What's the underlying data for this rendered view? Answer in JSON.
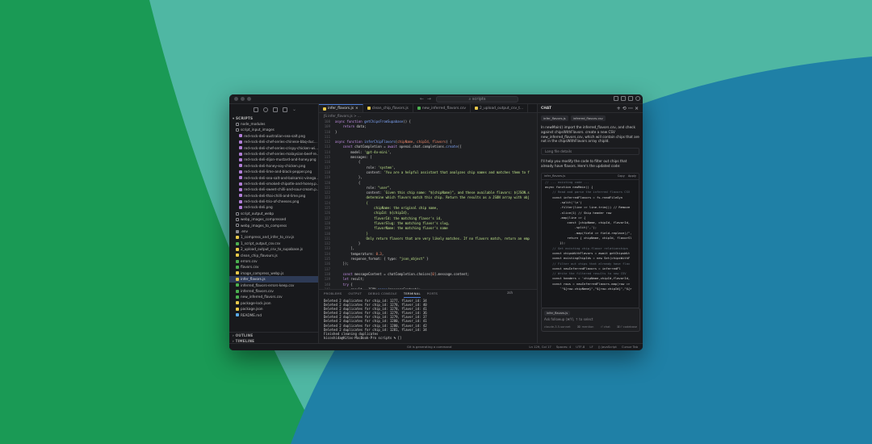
{
  "window": {
    "command_center": "scripts",
    "nav_arrows": "← →"
  },
  "explorer": {
    "section": "SCRIPTS",
    "items": [
      {
        "label": "node_modules",
        "indent": 1,
        "kind": "folder",
        "color": "#bdbdbd"
      },
      {
        "label": "script_input_images",
        "indent": 1,
        "kind": "folder",
        "color": "#bdbdbd"
      },
      {
        "label": "red-rock-deli-australian-sea-salt.png",
        "indent": 2,
        "kind": "img",
        "color": "#bdbdbd"
      },
      {
        "label": "red-rock-deli-chef-series-chinese-bbq-duc...",
        "indent": 2,
        "kind": "img",
        "color": "#bdbdbd"
      },
      {
        "label": "red-rock-deli-chef-series-crispy-chicken-wi...",
        "indent": 2,
        "kind": "img",
        "color": "#bdbdbd"
      },
      {
        "label": "red-rock-deli-chef-series-malaysian-beef-re...",
        "indent": 2,
        "kind": "img",
        "color": "#bdbdbd"
      },
      {
        "label": "red-rock-deli-dijon-mustard-and-honey.png",
        "indent": 2,
        "kind": "img",
        "color": "#bdbdbd"
      },
      {
        "label": "red-rock-deli-honey-soy-chicken.png",
        "indent": 2,
        "kind": "img",
        "color": "#bdbdbd"
      },
      {
        "label": "red-rock-deli-lime-and-black-pepper.png",
        "indent": 2,
        "kind": "img",
        "color": "#bdbdbd"
      },
      {
        "label": "red-rock-deli-sea-salt-and-balsamic-vinega...",
        "indent": 2,
        "kind": "img",
        "color": "#bdbdbd"
      },
      {
        "label": "red-rock-deli-smoked-chipotle-and-honey.p...",
        "indent": 2,
        "kind": "img",
        "color": "#bdbdbd"
      },
      {
        "label": "red-rock-deli-sweet-chilli-and-sour-cream.p...",
        "indent": 2,
        "kind": "img",
        "color": "#bdbdbd"
      },
      {
        "label": "red-rock-deli-thai-chilli-and-lime.png",
        "indent": 2,
        "kind": "img",
        "color": "#bdbdbd"
      },
      {
        "label": "red-rock-deli-trio-of-cheeses.png",
        "indent": 2,
        "kind": "img",
        "color": "#bdbdbd"
      },
      {
        "label": "red-rock-deli.png",
        "indent": 2,
        "kind": "img",
        "color": "#bdbdbd"
      },
      {
        "label": "script_output_webp",
        "indent": 1,
        "kind": "folder",
        "color": "#bdbdbd"
      },
      {
        "label": "webp_images_compressed",
        "indent": 1,
        "kind": "folder",
        "color": "#bdbdbd"
      },
      {
        "label": "webp_images_to_compress",
        "indent": 1,
        "kind": "folder",
        "color": "#bdbdbd"
      },
      {
        "label": ".env",
        "indent": 1,
        "kind": "env",
        "color": "#bdbdbd"
      },
      {
        "label": "1_compress_and_infer_to_csv.js",
        "indent": 1,
        "kind": "js",
        "color": "#bdbdbd"
      },
      {
        "label": "1_script_output_csv.csv",
        "indent": 1,
        "kind": "csv",
        "color": "#bdbdbd"
      },
      {
        "label": "2_upload_output_csv_to_supabase.js",
        "indent": 1,
        "kind": "js",
        "color": "#bdbdbd"
      },
      {
        "label": "clean_chip_flavours.js",
        "indent": 1,
        "kind": "js",
        "color": "#bdbdbd"
      },
      {
        "label": "errors.csv",
        "indent": 1,
        "kind": "csv",
        "color": "#bdbdbd"
      },
      {
        "label": "flavors.csv",
        "indent": 1,
        "kind": "csv",
        "color": "#bdbdbd"
      },
      {
        "label": "image_compress_webp.js",
        "indent": 1,
        "kind": "js",
        "color": "#bdbdbd"
      },
      {
        "label": "infer_flavors.js",
        "indent": 1,
        "kind": "js",
        "color": "#e0e0e0",
        "selected": true
      },
      {
        "label": "inferred_flavors-errors-keep.csv",
        "indent": 1,
        "kind": "csv",
        "color": "#bdbdbd"
      },
      {
        "label": "inferred_flavors.csv",
        "indent": 1,
        "kind": "csv",
        "color": "#bdbdbd"
      },
      {
        "label": "new_inferred_flavors.csv",
        "indent": 1,
        "kind": "csv",
        "color": "#bdbdbd"
      },
      {
        "label": "package-lock.json",
        "indent": 1,
        "kind": "json",
        "color": "#bdbdbd"
      },
      {
        "label": "package.json",
        "indent": 1,
        "kind": "json",
        "color": "#bdbdbd"
      },
      {
        "label": "README.md",
        "indent": 1,
        "kind": "md",
        "color": "#bdbdbd"
      }
    ],
    "outline": "OUTLINE",
    "timeline": "TIMELINE"
  },
  "file_colors": {
    "folder": "#bdbdbd",
    "img": "#b07dd6",
    "js": "#e8c84a",
    "csv": "#4caf50",
    "json": "#e8c84a",
    "md": "#5aa9e6",
    "env": "#8a8a90"
  },
  "editor": {
    "tabs": [
      {
        "label": "infer_flavors.js",
        "kind": "js",
        "active": true,
        "close": "×"
      },
      {
        "label": "clean_chip_flavors.js",
        "kind": "js",
        "active": false,
        "close": ""
      },
      {
        "label": "new_inferred_flavors.csv",
        "kind": "csv",
        "active": false,
        "close": ""
      },
      {
        "label": "2_upload_output_csv_t...",
        "kind": "js",
        "active": false,
        "close": ""
      }
    ],
    "breadcrumb": "JS infer_flavors.js > ...",
    "lines": [
      {
        "n": "108",
        "segs": [
          [
            "k",
            "async function "
          ],
          [
            "f",
            "getChipsFromSupabase"
          ],
          [
            "t",
            "() {"
          ]
        ]
      },
      {
        "n": "109",
        "segs": [
          [
            "t",
            "    "
          ],
          [
            "k",
            "return "
          ],
          [
            "t",
            "data;"
          ]
        ]
      },
      {
        "n": "110",
        "segs": [
          [
            "t",
            "}"
          ]
        ]
      },
      {
        "n": "111",
        "segs": []
      },
      {
        "n": "112",
        "segs": [
          [
            "k",
            "async function "
          ],
          [
            "f",
            "inferChipFlavors"
          ],
          [
            "t",
            "("
          ],
          [
            "p",
            "chipName, chipId, flavors"
          ],
          [
            "t",
            ") {"
          ]
        ]
      },
      {
        "n": "113",
        "segs": [
          [
            "t",
            "    "
          ],
          [
            "k",
            "const "
          ],
          [
            "t",
            "chatCompletion = "
          ],
          [
            "k",
            "await "
          ],
          [
            "t",
            "openai.chat.completions."
          ],
          [
            "f",
            "create"
          ],
          [
            "t",
            "({"
          ]
        ]
      },
      {
        "n": "114",
        "segs": [
          [
            "t",
            "        model: "
          ],
          [
            "s",
            "'gpt-4o-mini'"
          ],
          [
            "t",
            ","
          ]
        ]
      },
      {
        "n": "115",
        "segs": [
          [
            "t",
            "        messages: ["
          ]
        ]
      },
      {
        "n": "116",
        "segs": [
          [
            "t",
            "            {"
          ]
        ]
      },
      {
        "n": "117",
        "segs": [
          [
            "t",
            "                role: "
          ],
          [
            "s",
            "'system'"
          ],
          [
            "t",
            ","
          ]
        ]
      },
      {
        "n": "118",
        "segs": [
          [
            "t",
            "                content: "
          ],
          [
            "s",
            "'You are a helpful assistant that analyzes chip names and matches them to f"
          ]
        ]
      },
      {
        "n": "119",
        "segs": [
          [
            "t",
            "            },"
          ]
        ]
      },
      {
        "n": "120",
        "segs": [
          [
            "t",
            "            {"
          ]
        ]
      },
      {
        "n": "121",
        "segs": [
          [
            "t",
            "                role: "
          ],
          [
            "s",
            "\"user\""
          ],
          [
            "t",
            ","
          ]
        ]
      },
      {
        "n": "122",
        "segs": [
          [
            "t",
            "                content: "
          ],
          [
            "s",
            "`Given this chip name: \"${chipName}\", and these available flavors: ${JSON.s"
          ]
        ]
      },
      {
        "n": "123",
        "segs": [
          [
            "s",
            "                determine which flavors match this chip. Return the results as a JSON array with obj"
          ]
        ]
      },
      {
        "n": "124",
        "segs": [
          [
            "s",
            "                {"
          ]
        ]
      },
      {
        "n": "125",
        "segs": [
          [
            "s",
            "                    chipName: the original chip name,"
          ]
        ]
      },
      {
        "n": "126",
        "segs": [
          [
            "s",
            "                    chipId: ${chipId},"
          ]
        ]
      },
      {
        "n": "127",
        "segs": [
          [
            "s",
            "                    flavorId: the matching flavor's id,"
          ]
        ]
      },
      {
        "n": "128",
        "segs": [
          [
            "s",
            "                    flavorSlug: the matching flavor's slug,"
          ]
        ]
      },
      {
        "n": "129",
        "segs": [
          [
            "s",
            "                    flavorName: the matching flavor's name"
          ]
        ]
      },
      {
        "n": "130",
        "segs": [
          [
            "s",
            "                }"
          ]
        ]
      },
      {
        "n": "131",
        "segs": [
          [
            "s",
            "                Only return flavors that are very likely matches. If no flavors match, return an emp"
          ]
        ]
      },
      {
        "n": "132",
        "segs": [
          [
            "t",
            "            }"
          ]
        ]
      },
      {
        "n": "133",
        "segs": [
          [
            "t",
            "        ],"
          ]
        ]
      },
      {
        "n": "134",
        "segs": [
          [
            "t",
            "        temperature: "
          ],
          [
            "p",
            "0.3"
          ],
          [
            "t",
            ","
          ]
        ]
      },
      {
        "n": "135",
        "segs": [
          [
            "t",
            "        response_format: { type: "
          ],
          [
            "s",
            "\"json_object\""
          ],
          [
            "t",
            " }"
          ]
        ]
      },
      {
        "n": "136",
        "segs": [
          [
            "t",
            "    });"
          ]
        ]
      },
      {
        "n": "137",
        "segs": []
      },
      {
        "n": "138",
        "segs": [
          [
            "t",
            "    "
          ],
          [
            "k",
            "const "
          ],
          [
            "t",
            "messageContent = chatCompletion.choices["
          ],
          [
            "p",
            "0"
          ],
          [
            "t",
            "].message.content;"
          ]
        ]
      },
      {
        "n": "139",
        "segs": [
          [
            "t",
            "    "
          ],
          [
            "k",
            "let "
          ],
          [
            "t",
            "result;"
          ]
        ]
      },
      {
        "n": "140",
        "segs": [
          [
            "t",
            "    "
          ],
          [
            "k",
            "try "
          ],
          [
            "t",
            "{"
          ]
        ]
      },
      {
        "n": "141",
        "segs": [
          [
            "t",
            "        result = JSON."
          ],
          [
            "f",
            "parse"
          ],
          [
            "t",
            "(messageContent);"
          ]
        ]
      }
    ]
  },
  "panel": {
    "tabs": [
      "PROBLEMS",
      "OUTPUT",
      "DEBUG CONSOLE",
      "TERMINAL",
      "PORTS"
    ],
    "active_tab": "TERMINAL",
    "shell": "zsh",
    "terminal_lines": [
      "Deleted 2 duplicates for chip_id: 1277, flavor_id: 34",
      "Deleted 2 duplicates for chip_id: 1278, flavor_id: 40",
      "Deleted 2 duplicates for chip_id: 1278, flavor_id: 41",
      "Deleted 2 duplicates for chip_id: 1279, flavor_id: 36",
      "Deleted 2 duplicates for chip_id: 1279, flavor_id: 37",
      "Deleted 2 duplicates for chip_id: 1280, flavor_id: 41",
      "Deleted 2 duplicates for chip_id: 1280, flavor_id: 42",
      "Deleted 2 duplicates for chip_id: 1281, flavor_id: 34",
      "Finished cleaning duplicates",
      "kicoshida@Kitas-MacBook-Pro scripts % []"
    ]
  },
  "chat": {
    "title": "CHAT",
    "context_chips": [
      "infer_flavors.js",
      "inferred_flavors.csv"
    ],
    "user_prompt": "In newMain() import the inferred_flavors.csv, and check against chipsWithFlavors. create a new CSV new_inferred_flavors.csv, which will contain chips that are not in the chipsWithFlavors array chipId.",
    "fold_label": "Long file details",
    "reply": "I'll help you modify the code to filter out chips that already have flavors. Here's the updated code:",
    "code_file": "infer_flavors.js",
    "code_actions": [
      "Copy",
      "Apply"
    ],
    "code_lines": [
      "// ... existing code ...",
      "",
      "async function newMain() {",
      "    // Read and parse the inferred flavors CSV",
      "    const inferredFlavors = fs.readFileSyn",
      "        .split('\\n')",
      "        .filter(line => line.trim()) // Remove",
      "        .slice(1) // Skip header row",
      "        .map(line => {",
      "            const [chipName, chipId, flavorId,",
      "                .split(',');",
      "                .map(field => field.replace(/\",",
      "            return { chipName, chipId, flavorSl",
      "        });",
      "",
      "    // Get existing chip-flavor relationships",
      "    const chipsWithFlavors = await getChipsWit",
      "    const existingChipIds = new Set(chipsWithF",
      "",
      "    // Filter out chips that already have flav",
      "    const newInferredFlavors = inferredFl",
      "",
      "    // Write the filtered results to new CSV",
      "    const headers = 'chipName,chipId,flavorId,",
      "    const rows = newInferredFlavors.map(row =>",
      "        `\"${row.chipName}\",\"${row.chipId}\",\"${r"
    ],
    "input_chip": "infer_flavors.js",
    "input_placeholder": "Ask followup (⌘Y), ↑ to select",
    "input_model": "claude-3.5-sonnet",
    "input_mode": "⌘I mention",
    "input_submit": "⏎ chat",
    "input_codebase": "⌘⏎ codebase"
  },
  "statusbar": {
    "center": "Git is generating a command",
    "right": [
      "Ln 129, Col 17",
      "Spaces: 4",
      "UTF-8",
      "LF",
      "() JavaScript",
      "Cursor Tab"
    ]
  },
  "colors": {
    "bg_green": "#1a9a55",
    "bg_teal": "#4fb7a3",
    "bg_blue": "#1f80a6",
    "accent": "#4b7bd5"
  }
}
